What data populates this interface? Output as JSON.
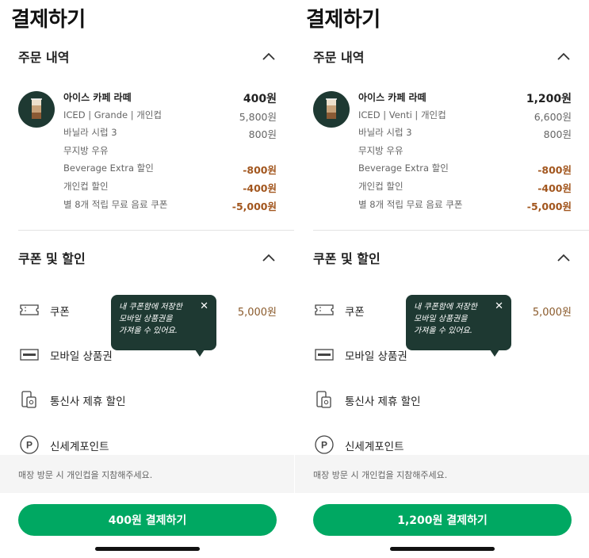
{
  "colors": {
    "brand_green": "#00a862",
    "dark_green": "#1e3932",
    "discount_brown": "#a2561e",
    "coupon_value": "#8a5a2b"
  },
  "screens": [
    {
      "title": "결제하기",
      "order_section": {
        "title": "주문 내역",
        "icon": "chevron-up-icon",
        "rows": [
          {
            "label": "아이스 카페 라떼",
            "value": "400원",
            "type": "title"
          },
          {
            "label": "ICED | Grande | 개인컵",
            "value": "5,800원",
            "type": "normal"
          },
          {
            "label": "바닐라 시럽 3",
            "value": "800원",
            "type": "normal"
          },
          {
            "label": "무지방 우유",
            "value": "",
            "type": "normal"
          },
          {
            "label": "Beverage Extra 할인",
            "value": "-800원",
            "type": "discount"
          },
          {
            "label": "개인컵 할인",
            "value": "-400원",
            "type": "discount"
          },
          {
            "label": "별 8개 적립 무료 음료 쿠폰",
            "value": "-5,000원",
            "type": "discount"
          }
        ]
      },
      "discount_section": {
        "title": "쿠폰 및 할인",
        "icon": "chevron-up-icon",
        "items": [
          {
            "label": "쿠폰",
            "value": "5,000원",
            "icon": "coupon-ticket-icon"
          },
          {
            "label": "모바일 상품권",
            "value": "",
            "icon": "gift-card-icon"
          },
          {
            "label": "통신사 제휴 할인",
            "value": "",
            "icon": "mobile-carrier-icon"
          },
          {
            "label": "신세계포인트",
            "value": "",
            "icon": "point-icon"
          }
        ]
      },
      "tooltip": {
        "text": "내 쿠폰함에 저장한\n모바일 상품권을\n가져올 수 있어요.",
        "close": "✕"
      },
      "notice": "매장 방문 시 개인컵을 지참해주세요.",
      "pay_button": "400원 결제하기"
    },
    {
      "title": "결제하기",
      "order_section": {
        "title": "주문 내역",
        "icon": "chevron-up-icon",
        "rows": [
          {
            "label": "아이스 카페 라떼",
            "value": "1,200원",
            "type": "title"
          },
          {
            "label": "ICED | Venti | 개인컵",
            "value": "6,600원",
            "type": "normal"
          },
          {
            "label": "바닐라 시럽 3",
            "value": "800원",
            "type": "normal"
          },
          {
            "label": "무지방 우유",
            "value": "",
            "type": "normal"
          },
          {
            "label": "Beverage Extra 할인",
            "value": "-800원",
            "type": "discount"
          },
          {
            "label": "개인컵 할인",
            "value": "-400원",
            "type": "discount"
          },
          {
            "label": "별 8개 적립 무료 음료 쿠폰",
            "value": "-5,000원",
            "type": "discount"
          }
        ]
      },
      "discount_section": {
        "title": "쿠폰 및 할인",
        "icon": "chevron-up-icon",
        "items": [
          {
            "label": "쿠폰",
            "value": "5,000원",
            "icon": "coupon-ticket-icon"
          },
          {
            "label": "모바일 상품권",
            "value": "",
            "icon": "gift-card-icon"
          },
          {
            "label": "통신사 제휴 할인",
            "value": "",
            "icon": "mobile-carrier-icon"
          },
          {
            "label": "신세계포인트",
            "value": "",
            "icon": "point-icon"
          }
        ]
      },
      "tooltip": {
        "text": "내 쿠폰함에 저장한\n모바일 상품권을\n가져올 수 있어요.",
        "close": "✕"
      },
      "notice": "매장 방문 시 개인컵을 지참해주세요.",
      "pay_button": "1,200원 결제하기"
    }
  ]
}
